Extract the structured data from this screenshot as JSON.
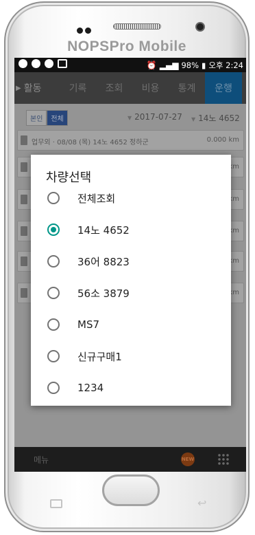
{
  "device": {
    "brand": "NOPSPro Mobile"
  },
  "status_bar": {
    "battery": "98%",
    "time": "오후 2:24"
  },
  "tabs": [
    {
      "label": "활동"
    },
    {
      "label": "기록"
    },
    {
      "label": "조회"
    },
    {
      "label": "비용"
    },
    {
      "label": "통계"
    },
    {
      "label": "운행",
      "active": true
    }
  ],
  "filter": {
    "own_label": "본인",
    "all_label": "전체",
    "date": "2017-07-27",
    "vehicle": "14노 4652"
  },
  "list_rows": [
    {
      "text": "업무외 · 08/08 (목) 14노 4652 정하군",
      "km": "0.000 km"
    },
    {
      "text": "",
      "km": "km"
    },
    {
      "text": "",
      "km": "km"
    },
    {
      "text": "",
      "km": "km"
    },
    {
      "text": "",
      "km": "km"
    },
    {
      "text": "",
      "km": "km"
    }
  ],
  "dialog": {
    "title": "차량선택",
    "options": [
      {
        "label": "전체조회",
        "selected": false
      },
      {
        "label": "14노 4652",
        "selected": true
      },
      {
        "label": "36어 8823",
        "selected": false
      },
      {
        "label": "56소 3879",
        "selected": false
      },
      {
        "label": "MS7",
        "selected": false
      },
      {
        "label": "신규구매1",
        "selected": false
      },
      {
        "label": "1234",
        "selected": false
      }
    ]
  },
  "bottom_bar": {
    "menu_label": "메뉴",
    "new_badge": "NEW"
  },
  "colors": {
    "accent": "#009688",
    "active_tab": "#0e4e7b"
  }
}
